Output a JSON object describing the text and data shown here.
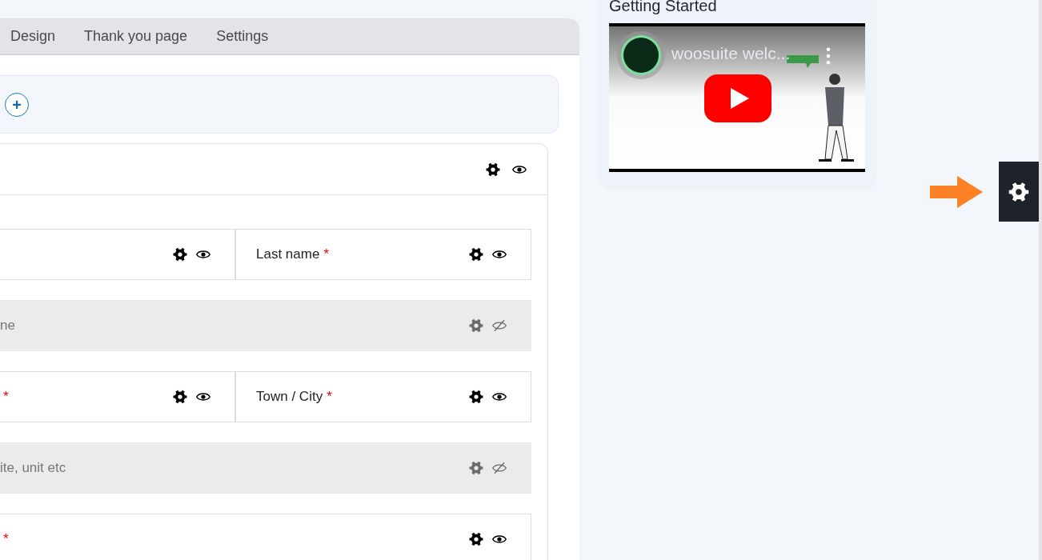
{
  "tabs": [
    {
      "label": "Design",
      "selected": false
    },
    {
      "label": "Thank you page",
      "selected": false
    },
    {
      "label": "Settings",
      "selected": false
    }
  ],
  "add_button": {
    "label": "+"
  },
  "section": {
    "visible": true
  },
  "fields": [
    {
      "cells": [
        {
          "visible": true
        },
        {
          "label": "Last name",
          "required_mark": "*",
          "visible": true
        }
      ]
    },
    {
      "cells": [
        {
          "label": "ne",
          "visible": false
        }
      ]
    },
    {
      "cells": [
        {
          "required_mark": "*",
          "visible": true
        },
        {
          "label": "Town / City",
          "required_mark": "*",
          "visible": true
        }
      ]
    },
    {
      "cells": [
        {
          "label": "ite, unit etc",
          "visible": false
        }
      ]
    },
    {
      "cells": [
        {
          "required_mark": "*",
          "visible": true
        }
      ]
    }
  ],
  "getting_started": {
    "title": "Getting Started",
    "video": {
      "title": "woosuite welc..."
    }
  }
}
